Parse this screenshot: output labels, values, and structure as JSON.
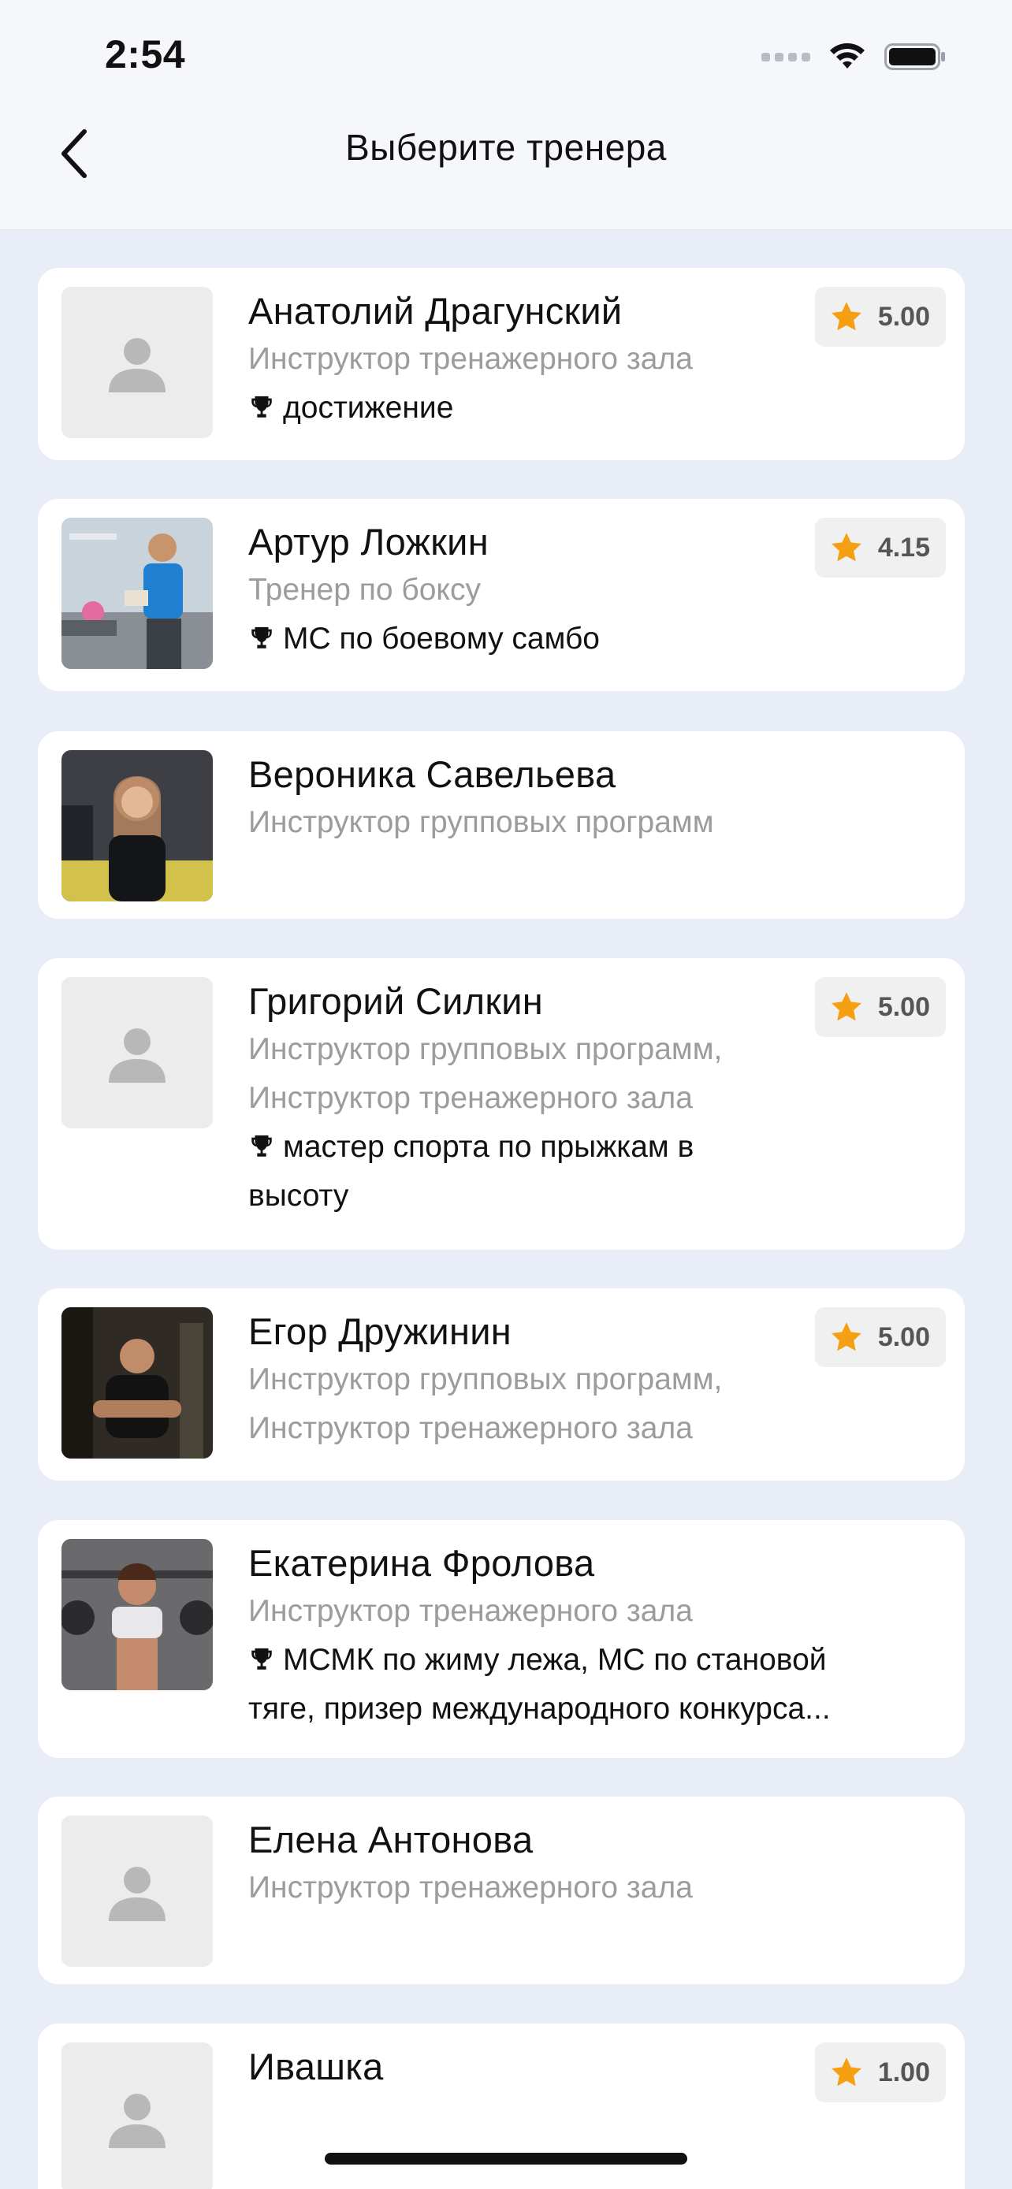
{
  "status_bar": {
    "time": "2:54"
  },
  "header": {
    "title": "Выберите тренера"
  },
  "colors": {
    "accent_star": "#f5a012",
    "background": "#e8edf7",
    "secondary_text": "#9c9c9c"
  },
  "trainers": [
    {
      "name": "Анатолий Драгунский",
      "specialization": [
        "Инструктор тренажерного зала"
      ],
      "achievement": [
        "достижение"
      ],
      "rating": "5.00",
      "photo": "placeholder"
    },
    {
      "name": "Артур Ложкин",
      "specialization": [
        "Тренер по боксу"
      ],
      "achievement": [
        "МС по боевому самбо"
      ],
      "rating": "4.15",
      "photo": "photo"
    },
    {
      "name": "Вероника Савельева",
      "specialization": [
        "Инструктор групповых программ"
      ],
      "achievement": [],
      "rating": "",
      "photo": "photo"
    },
    {
      "name": "Григорий Силкин",
      "specialization": [
        "Инструктор групповых программ,",
        "Инструктор тренажерного зала"
      ],
      "achievement": [
        "мастер спорта по прыжкам в",
        "высоту"
      ],
      "rating": "5.00",
      "photo": "placeholder"
    },
    {
      "name": "Егор Дружинин",
      "specialization": [
        "Инструктор групповых программ,",
        "Инструктор тренажерного зала"
      ],
      "achievement": [],
      "rating": "5.00",
      "photo": "photo"
    },
    {
      "name": "Екатерина Фролова",
      "specialization": [
        "Инструктор тренажерного зала"
      ],
      "achievement": [
        "МСМК по жиму лежа, МС по становой",
        "тяге, призер международного конкурса..."
      ],
      "rating": "",
      "photo": "photo"
    },
    {
      "name": "Елена Антонова",
      "specialization": [
        "Инструктор тренажерного зала"
      ],
      "achievement": [],
      "rating": "",
      "photo": "placeholder"
    },
    {
      "name": "Ивашка",
      "specialization": [],
      "achievement": [],
      "rating": "1.00",
      "photo": "placeholder"
    }
  ]
}
